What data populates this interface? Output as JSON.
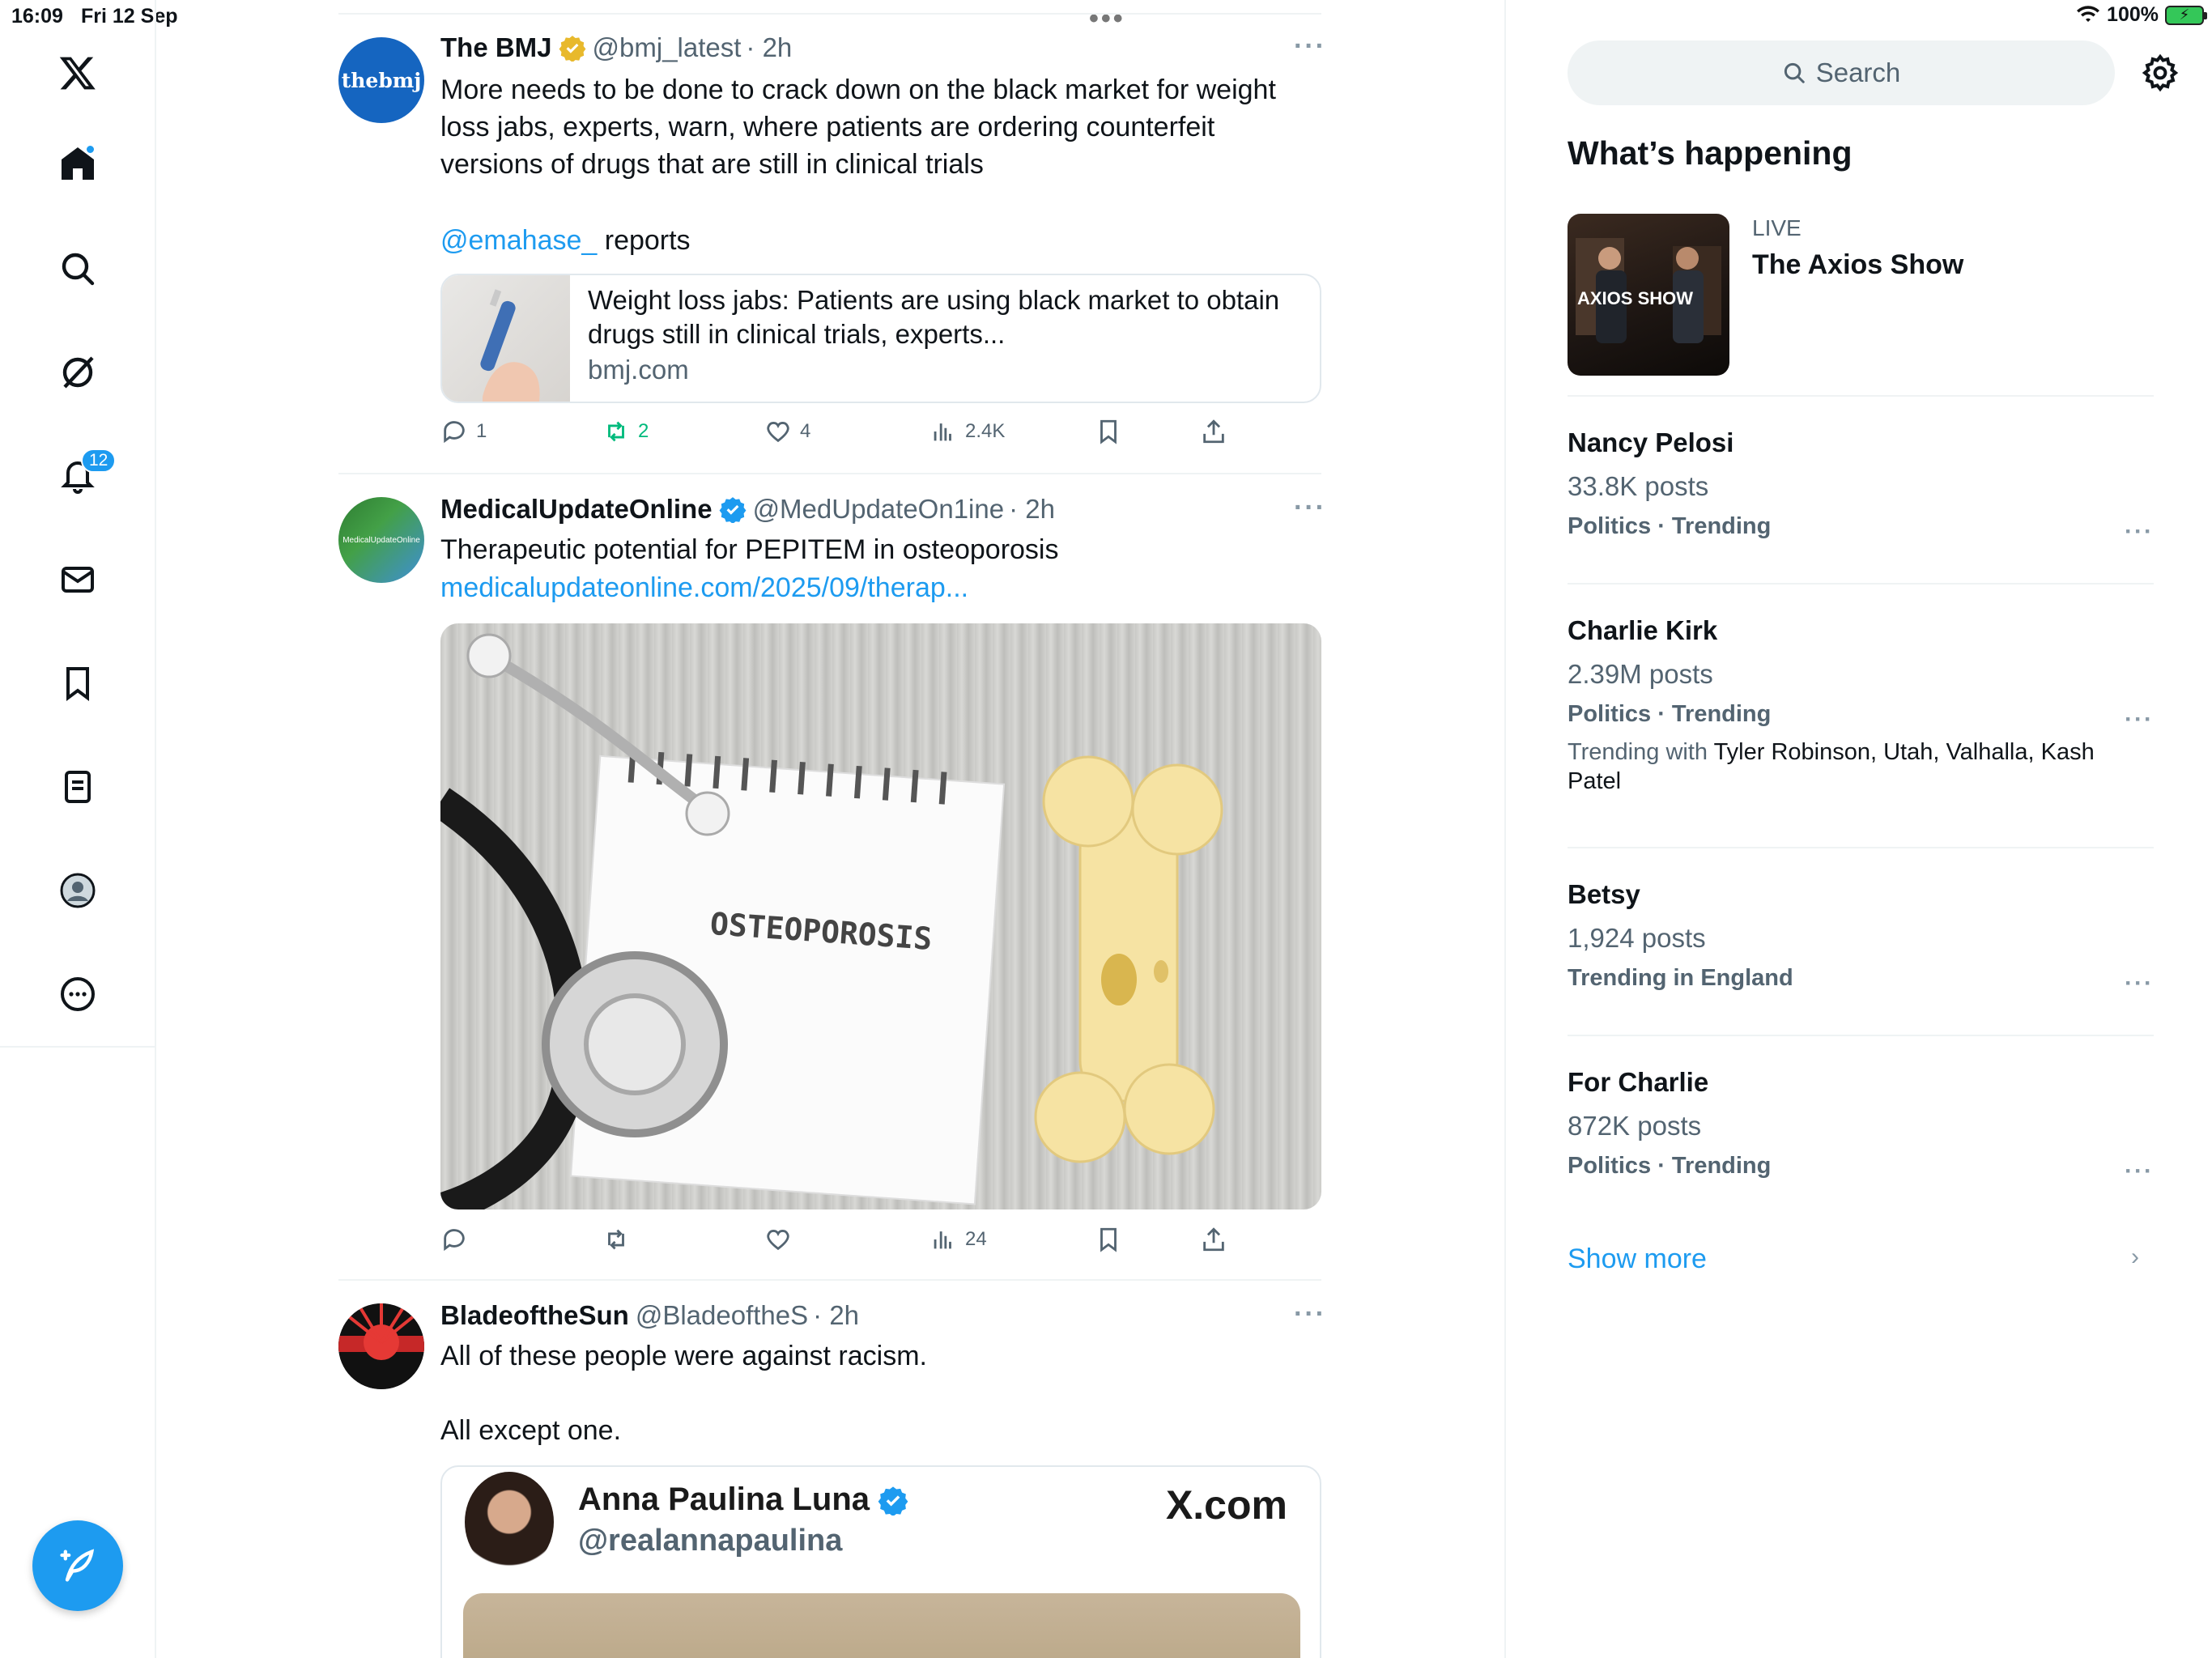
{
  "status_bar": {
    "time": "16:09",
    "date": "Fri 12 Sep",
    "battery": "100%"
  },
  "nav": {
    "logo": "x-logo-icon",
    "items": [
      "home-icon",
      "search-icon",
      "grok-icon",
      "notifications-icon",
      "messages-icon",
      "bookmarks-icon",
      "lists-icon",
      "profile-icon",
      "more-icon"
    ],
    "notifications_badge": "12",
    "compose": "compose-icon"
  },
  "colors": {
    "accent": "#1d9bf0",
    "text": "#0f1419",
    "muted": "#536471",
    "retweet_green": "#00ba7c",
    "divider": "#eff3f4"
  },
  "tweets": [
    {
      "name": "The BMJ",
      "handle": "@bmj_latest",
      "time": "· 2h",
      "avatar_text": "thebmj",
      "text": "More needs to be done to crack down on the black market for weight loss jabs, experts, warn, where patients are ordering counterfeit versions of drugs that are still in clinical trials",
      "mention": "@emahase_",
      "mention_suffix": " reports",
      "card_title": "Weight loss jabs: Patients are using black market to obtain drugs still in clinical trials, experts...",
      "card_domain": "bmj.com",
      "replies": "1",
      "reposts": "2",
      "likes": "4",
      "views": "2.4K"
    },
    {
      "name": "MedicalUpdateOnline",
      "handle": "@MedUpdateOn1ine",
      "time": "· 2h",
      "avatar_text": "MedicalUpdateOnline",
      "text": "Therapeutic potential for PEPITEM in osteoporosis",
      "link": "medicalupdateonline.com/2025/09/therap...",
      "image_text": "OSTEOPOROSIS",
      "views": "24"
    },
    {
      "name": "BladeoftheSun",
      "handle": "@BladeoftheS",
      "time": "· 2h",
      "text_line1": "All of these people were against racism.",
      "text_line2": "All except one.",
      "embed_name": "Anna Paulina Luna",
      "embed_handle": "@realannapaulina",
      "embed_brand": "X.com"
    }
  ],
  "sidebar": {
    "search_placeholder": "Search",
    "title": "What’s happening",
    "live": {
      "label": "LIVE",
      "title": "The Axios Show",
      "thumb_text": "AXIOS SHOW"
    },
    "trends": [
      {
        "name": "Nancy Pelosi",
        "posts": "33.8K posts",
        "category": "Politics · Trending"
      },
      {
        "name": "Charlie Kirk",
        "posts": "2.39M posts",
        "category": "Politics · Trending",
        "with_label": "Trending with",
        "with_terms": "Tyler Robinson, Utah, Valhalla, Kash Patel"
      },
      {
        "name": "Betsy",
        "posts": "1,924 posts",
        "category": "Trending in England"
      },
      {
        "name": "For Charlie",
        "posts": "872K posts",
        "category": "Politics · Trending"
      }
    ],
    "show_more": "Show more"
  }
}
